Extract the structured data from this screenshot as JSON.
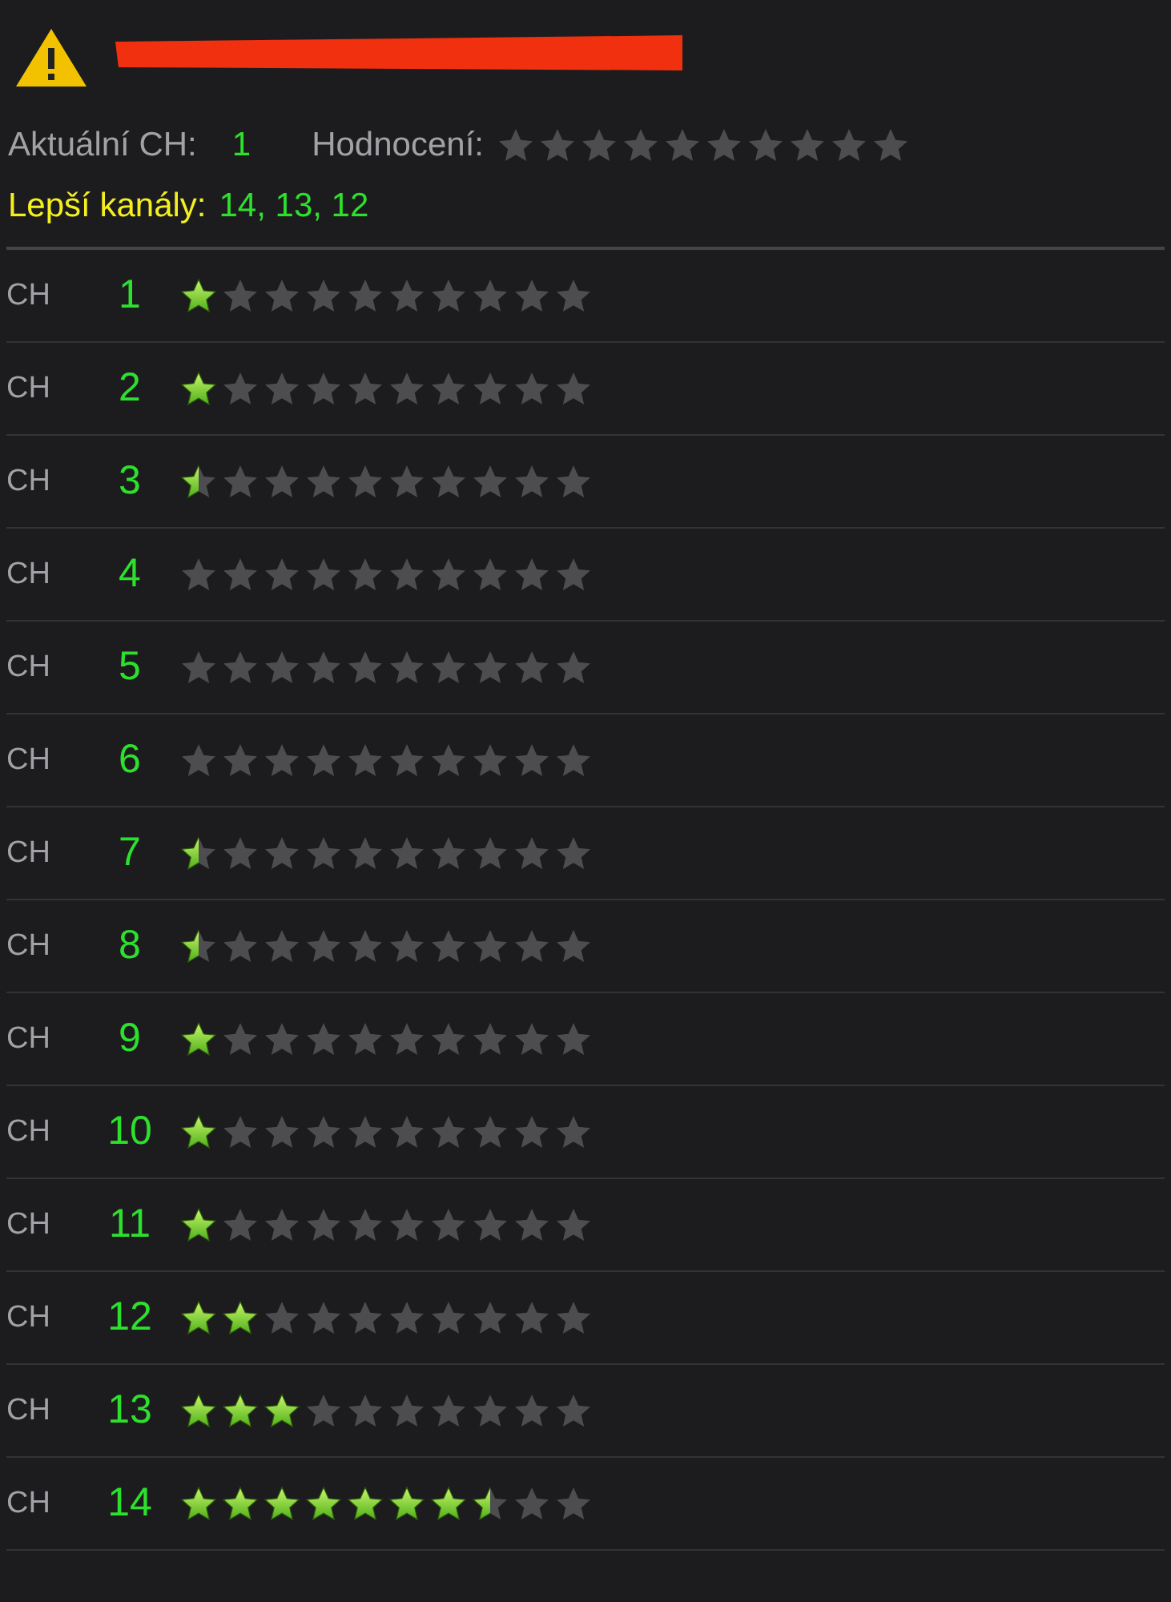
{
  "header": {
    "current_label": "Aktuální CH:",
    "current_value": "1",
    "rating": {
      "label": "Hodnocení:",
      "stars": 0
    },
    "best_label": "Lepší kanály:",
    "best_value": "14, 13, 12"
  },
  "channels": [
    {
      "label": "CH",
      "number": "1",
      "stars": 1
    },
    {
      "label": "CH",
      "number": "2",
      "stars": 1
    },
    {
      "label": "CH",
      "number": "3",
      "stars": 0.5
    },
    {
      "label": "CH",
      "number": "4",
      "stars": 0
    },
    {
      "label": "CH",
      "number": "5",
      "stars": 0
    },
    {
      "label": "CH",
      "number": "6",
      "stars": 0
    },
    {
      "label": "CH",
      "number": "7",
      "stars": 0.5
    },
    {
      "label": "CH",
      "number": "8",
      "stars": 0.5
    },
    {
      "label": "CH",
      "number": "9",
      "stars": 1
    },
    {
      "label": "CH",
      "number": "10",
      "stars": 1
    },
    {
      "label": "CH",
      "number": "11",
      "stars": 1
    },
    {
      "label": "CH",
      "number": "12",
      "stars": 2
    },
    {
      "label": "CH",
      "number": "13",
      "stars": 3
    },
    {
      "label": "CH",
      "number": "14",
      "stars": 7.5
    }
  ]
}
